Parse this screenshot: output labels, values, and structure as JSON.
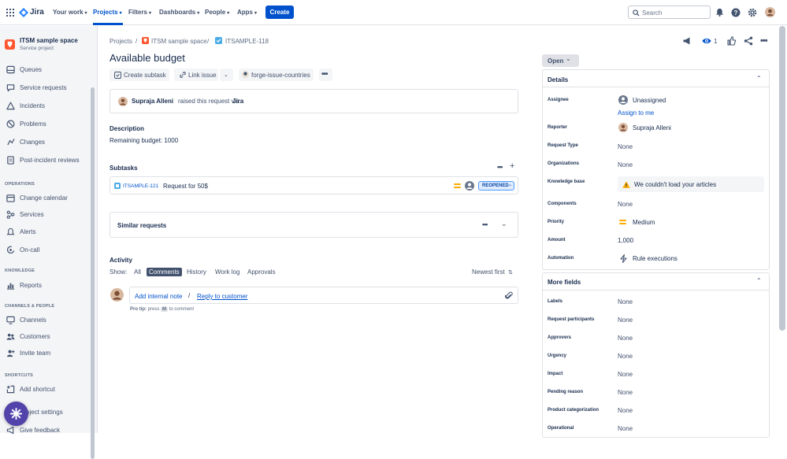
{
  "app": {
    "name": "Jira"
  },
  "topnav": {
    "items": [
      {
        "label": "Your work"
      },
      {
        "label": "Projects"
      },
      {
        "label": "Filters"
      },
      {
        "label": "Dashboards"
      },
      {
        "label": "People"
      },
      {
        "label": "Apps"
      }
    ],
    "create_label": "Create",
    "search_placeholder": "Search"
  },
  "sidebar": {
    "project_name": "ITSM sample space",
    "project_type": "Service project",
    "items": [
      {
        "label": "Queues",
        "icon": "queues-icon"
      },
      {
        "label": "Service requests",
        "icon": "chat-bubble-icon"
      },
      {
        "label": "Incidents",
        "icon": "warning-triangle-icon"
      },
      {
        "label": "Problems",
        "icon": "prohibited-icon"
      },
      {
        "label": "Changes",
        "icon": "changes-icon"
      },
      {
        "label": "Post-incident reviews",
        "icon": "document-icon"
      }
    ],
    "operations_heading": "OPERATIONS",
    "operations": [
      {
        "label": "Change calendar",
        "icon": "calendar-icon"
      },
      {
        "label": "Services",
        "icon": "services-icon"
      },
      {
        "label": "Alerts",
        "icon": "bell-icon"
      },
      {
        "label": "On-call",
        "icon": "on-call-icon"
      }
    ],
    "knowledge_heading": "KNOWLEDGE",
    "knowledge": [
      {
        "label": "Reports",
        "icon": "reports-icon"
      }
    ],
    "channels_heading": "CHANNELS & PEOPLE",
    "channels": [
      {
        "label": "Channels",
        "icon": "monitor-icon"
      },
      {
        "label": "Customers",
        "icon": "people-icon"
      },
      {
        "label": "Invite team",
        "icon": "add-person-icon"
      }
    ],
    "shortcuts_heading": "SHORTCUTS",
    "shortcuts": [
      {
        "label": "Add shortcut",
        "icon": "add-shortcut-icon"
      },
      {
        "label": "Project settings",
        "icon": "settings-icon"
      },
      {
        "label": "Give feedback",
        "icon": "megaphone-icon"
      }
    ]
  },
  "breadcrumb": {
    "projects": "Projects",
    "space": "ITSM sample space",
    "issue_key": "ITSAMPLE-118"
  },
  "issue": {
    "title": "Available budget",
    "actions": {
      "create_subtask": "Create subtask",
      "link_issue": "Link issue",
      "app": "forge-issue-countries"
    },
    "requester": {
      "name": "Supraja Alleni",
      "text": "raised this request via",
      "channel": "Jira"
    },
    "description_label": "Description",
    "description": "Remaining budget: 1000",
    "subtasks_label": "Subtasks",
    "subtask": {
      "key": "ITSAMPLE-121",
      "summary": "Request for 50$",
      "status": "REOPENED"
    },
    "similar_requests": "Similar requests",
    "watchers": "1"
  },
  "activity": {
    "label": "Activity",
    "show_label": "Show:",
    "tabs": [
      "All",
      "Comments",
      "History",
      "Work log",
      "Approvals"
    ],
    "active_tab": "Comments",
    "sort": "Newest first",
    "add_internal_note": "Add internal note",
    "separator": "/",
    "reply_to_customer": "Reply to customer",
    "pro_tip_label": "Pro tip:",
    "pro_tip_pre": "press",
    "pro_tip_key": "M",
    "pro_tip_post": "to comment"
  },
  "right_panel": {
    "status": "Open",
    "details_heading": "Details",
    "fields": [
      {
        "label": "Assignee",
        "value": "Unassigned"
      },
      {
        "label": "Reporter",
        "value": "Supraja Alleni"
      },
      {
        "label": "Request Type",
        "value": "None"
      },
      {
        "label": "Organizations",
        "value": "None"
      },
      {
        "label": "Knowledge base",
        "value": "We couldn't load your articles"
      },
      {
        "label": "Components",
        "value": "None"
      },
      {
        "label": "Priority",
        "value": "Medium"
      },
      {
        "label": "Amount",
        "value": "1,000"
      },
      {
        "label": "Automation",
        "value": "Rule executions"
      }
    ],
    "assign_to_me": "Assign to me",
    "more_fields_heading": "More fields",
    "more_fields": [
      {
        "label": "Labels",
        "value": "None"
      },
      {
        "label": "Request participants",
        "value": "None"
      },
      {
        "label": "Approvers",
        "value": "None"
      },
      {
        "label": "Urgency",
        "value": "None"
      },
      {
        "label": "Impact",
        "value": "None"
      },
      {
        "label": "Pending reason",
        "value": "None"
      },
      {
        "label": "Product categorization",
        "value": "None"
      },
      {
        "label": "Operational",
        "value": "None"
      }
    ]
  },
  "colors": {
    "brand": "#0052cc",
    "status_badge_bg": "#deebff",
    "priority_medium": "#ffab00",
    "warning": "#ffab00"
  }
}
